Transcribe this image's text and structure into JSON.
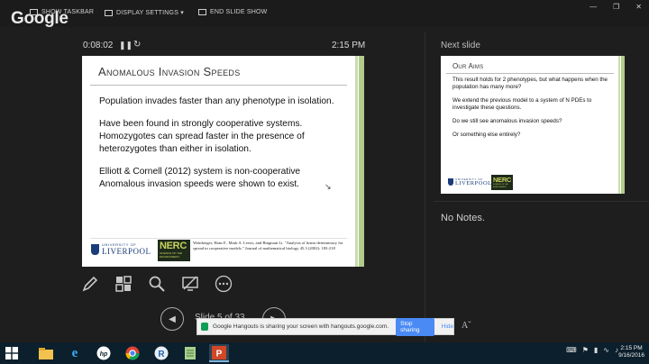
{
  "topbar": {
    "brand": "Google",
    "items": [
      "SHOW TASKBAR",
      "DISPLAY SETTINGS ▾",
      "END SLIDE SHOW"
    ]
  },
  "presenter": {
    "timer": "0:08:02",
    "clock": "2:15 PM",
    "slide_counter": "Slide 5 of 33",
    "next_label": "Next slide",
    "notes": "No Notes."
  },
  "current_slide": {
    "title": "Anomalous Invasion Speeds",
    "paragraphs": [
      "Population invades faster than any phenotype in isolation.",
      "Have been found in strongly cooperative systems. Homozygotes can spread faster in the presence of heterozygotes than either in isolation.",
      "Elliott & Cornell (2012) system is non-cooperative Anomalous invasion speeds were shown to exist."
    ],
    "liv_small": "UNIVERSITY OF",
    "liv_big": "LIVERPOOL",
    "nerc": "NERC",
    "nerc_sub": "SCIENCE OF THE ENVIRONMENT",
    "citation": "Weinberger, Hans F., Mark A. Lewis, and Bingtuan Li. \"Analysis of linear determinacy for spread in cooperative models.\" Journal of mathematical biology 45.3 (2002): 183-218"
  },
  "next_slide": {
    "title": "Our Aims",
    "paragraphs": [
      "This result holds for 2 phenotypes, but what happens when the population has many more?",
      "We extend the previous model to a system of N PDEs to investigate these questions.",
      "Do we still see anomalous invasion speeds?",
      "Or something else entirely?"
    ]
  },
  "hangouts": {
    "message": "Google Hangouts is sharing your screen with hangouts.google.com.",
    "stop": "Stop sharing",
    "hide": "Hide"
  },
  "taskbar": {
    "time": "2:15 PM",
    "date": "9/16/2016"
  }
}
